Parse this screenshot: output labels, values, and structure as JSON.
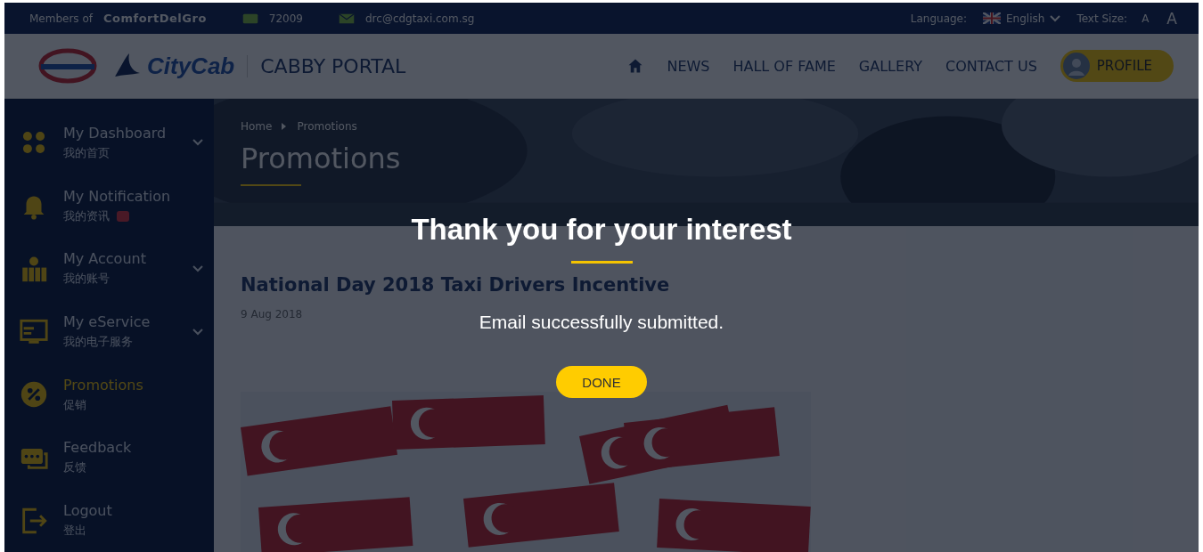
{
  "top_bar": {
    "members_label": "Members of",
    "group_logo": "ComfortDelGro",
    "hotline": "72009",
    "email": "drc@cdgtaxi.com.sg",
    "language_label": "Language:",
    "language": "English",
    "text_size_label": "Text Size:",
    "text_sizes": [
      "A",
      "A"
    ]
  },
  "header": {
    "brand": "CityCab",
    "portal_title": "CABBY PORTAL",
    "nav": [
      {
        "label": "NEWS"
      },
      {
        "label": "HALL OF FAME"
      },
      {
        "label": "GALLERY"
      },
      {
        "label": "CONTACT US"
      }
    ],
    "profile_button": "PROFILE"
  },
  "sidebar": {
    "items": [
      {
        "kind": "dashboard",
        "label": "My Dashboard",
        "label_zh": "我的首页",
        "expandable": true,
        "badge": false,
        "selected": false
      },
      {
        "kind": "notification",
        "label": "My Notification",
        "label_zh": "我的资讯",
        "expandable": false,
        "badge": true,
        "selected": false
      },
      {
        "kind": "account",
        "label": "My Account",
        "label_zh": "我的账号",
        "expandable": true,
        "badge": false,
        "selected": false
      },
      {
        "kind": "eservice",
        "label": "My eService",
        "label_zh": "我的电子服务",
        "expandable": true,
        "badge": false,
        "selected": false
      },
      {
        "kind": "promotions",
        "label": "Promotions",
        "label_zh": "促销",
        "expandable": false,
        "badge": false,
        "selected": true
      },
      {
        "kind": "feedback",
        "label": "Feedback",
        "label_zh": "反馈",
        "expandable": false,
        "badge": false,
        "selected": false
      },
      {
        "kind": "logout",
        "label": "Logout",
        "label_zh": "登出",
        "expandable": false,
        "badge": false,
        "selected": false
      }
    ]
  },
  "breadcrumb": [
    "Home",
    "Promotions"
  ],
  "page_title": "Promotions",
  "article": {
    "title": "National Day 2018 Taxi Drivers Incentive",
    "date": "9 Aug 2018"
  },
  "dialog": {
    "title": "Thank you for your interest",
    "message": "Email successfully submitted.",
    "button": "DONE"
  }
}
